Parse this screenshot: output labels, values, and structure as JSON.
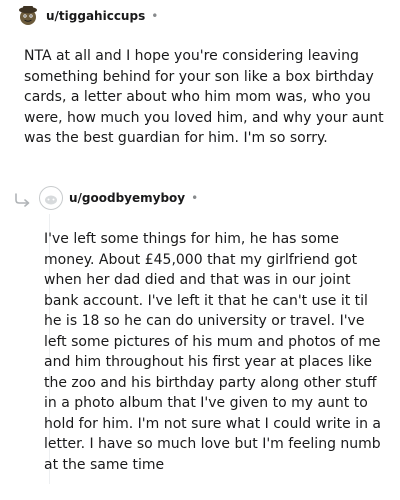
{
  "comments": [
    {
      "username": "u/tiggahiccups",
      "separator": "•",
      "avatar_icon": "snoo-avatar-icon",
      "body": "NTA at all and I hope you're considering leaving something behind for your son like a box birthday cards, a letter about who him mom was, who you were, how much you loved him, and why your aunt was the best guardian for him. I'm so sorry."
    },
    {
      "username": "u/goodbyemyboy",
      "separator": "•",
      "avatar_icon": "default-avatar-icon",
      "reply_icon": "reply-arrow-icon",
      "body": "I've left some things for him, he has some money. About £45,000 that my girlfriend got when her dad died and that was in our joint bank account. I've left it that he can't use it til he is 18 so he can do university or travel. I've left some pictures of his mum and photos of me and him throughout his first year at places like the zoo and his birthday party along other stuff in a photo album that I've given to my aunt to hold for him. I'm not sure what I could write in a letter. I have so much love but I'm feeling numb at the same time"
    }
  ]
}
